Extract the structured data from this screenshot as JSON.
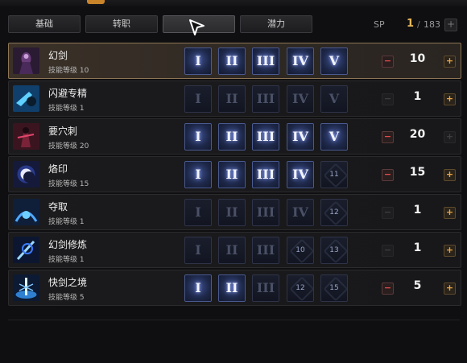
{
  "tabs": [
    {
      "label": "基础"
    },
    {
      "label": "转职"
    },
    {
      "label": "",
      "active": true
    },
    {
      "label": "潜力"
    }
  ],
  "sp": {
    "label": "SP",
    "current": "1",
    "separator": "/",
    "total": "183",
    "plus": "+"
  },
  "level_prefix": "技能等级",
  "skills": [
    {
      "name": "幻剑",
      "level_text": "技能等级 10",
      "value": "10",
      "selected": true,
      "icon": "phantom-sword-icon",
      "tiers": [
        "I",
        "II",
        "III",
        "IV",
        "V"
      ],
      "tier_on": [
        true,
        true,
        true,
        true,
        true
      ],
      "minus_enabled": true,
      "plus_enabled": true
    },
    {
      "name": "闪避专精",
      "level_text": "技能等级 1",
      "value": "1",
      "icon": "evasion-icon",
      "tiers": [
        "I",
        "II",
        "III",
        "IV",
        "V"
      ],
      "tier_on": [
        false,
        false,
        false,
        false,
        false
      ],
      "minus_enabled": false,
      "plus_enabled": true
    },
    {
      "name": "要穴刺",
      "level_text": "技能等级 20",
      "value": "20",
      "icon": "vital-stab-icon",
      "tiers": [
        "I",
        "II",
        "III",
        "IV",
        "V"
      ],
      "tier_on": [
        true,
        true,
        true,
        true,
        true
      ],
      "minus_enabled": true,
      "plus_enabled": false
    },
    {
      "name": "烙印",
      "level_text": "技能等级 15",
      "value": "15",
      "icon": "brand-icon",
      "tiers": [
        "I",
        "II",
        "III",
        "IV",
        "11"
      ],
      "tier_on": [
        true,
        true,
        true,
        true,
        false
      ],
      "minus_enabled": true,
      "plus_enabled": true
    },
    {
      "name": "夺取",
      "level_text": "技能等级 1",
      "value": "1",
      "icon": "seize-icon",
      "tiers": [
        "I",
        "II",
        "III",
        "IV",
        "12"
      ],
      "tier_on": [
        false,
        false,
        false,
        false,
        false
      ],
      "minus_enabled": false,
      "plus_enabled": true
    },
    {
      "name": "幻剑修炼",
      "level_text": "技能等级 1",
      "value": "1",
      "icon": "sword-training-icon",
      "tiers": [
        "I",
        "II",
        "III",
        "10",
        "13"
      ],
      "tier_on": [
        false,
        false,
        false,
        false,
        false
      ],
      "minus_enabled": false,
      "plus_enabled": true
    },
    {
      "name": "快剑之境",
      "level_text": "技能等级 5",
      "value": "5",
      "icon": "swift-blade-icon",
      "tiers": [
        "I",
        "II",
        "III",
        "12",
        "15"
      ],
      "tier_on": [
        true,
        true,
        false,
        false,
        false
      ],
      "minus_enabled": true,
      "plus_enabled": true
    }
  ],
  "colors": {
    "accent": "#e8b85a",
    "minus": "#e34b4b",
    "plus": "#e9a444",
    "tier_active": "#3d4f8f"
  }
}
